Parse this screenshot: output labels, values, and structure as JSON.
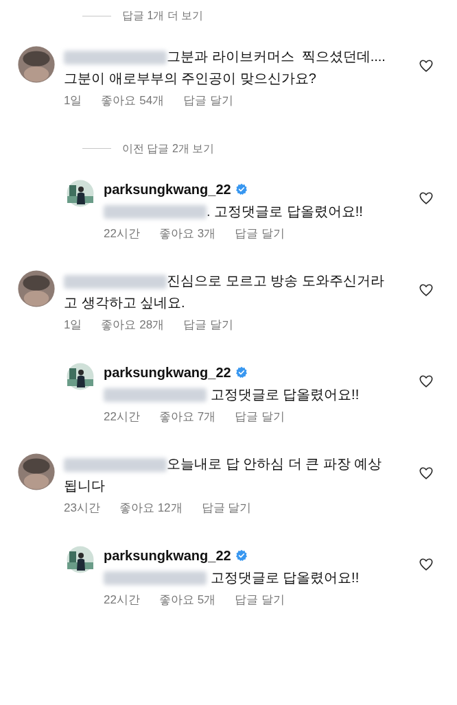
{
  "items": [
    {
      "kind": "view_replies",
      "text": "답글 1개 더 보기"
    },
    {
      "kind": "comment",
      "redacted_prefix": true,
      "text": "그분과 라이브커머스  찍으셨던데.... 그분이 애로부부의 주인공이 맞으신가요?",
      "time": "1일",
      "likes": "좋아요 54개",
      "reply": "답글 달기",
      "liked": false
    },
    {
      "kind": "view_replies",
      "text": "이전 답글 2개 보기"
    },
    {
      "kind": "reply",
      "username": "parksungkwang_22",
      "verified": true,
      "redacted_prefix": true,
      "text": ". 고정댓글로 답올렸어요!!",
      "time": "22시간",
      "likes": "좋아요 3개",
      "reply": "답글 달기",
      "liked": false
    },
    {
      "kind": "comment",
      "redacted_prefix": true,
      "text": "진심으로 모르고 방송 도와주신거라고 생각하고 싶네요.",
      "time": "1일",
      "likes": "좋아요 28개",
      "reply": "답글 달기",
      "liked": false
    },
    {
      "kind": "reply",
      "username": "parksungkwang_22",
      "verified": true,
      "redacted_prefix": true,
      "text": " 고정댓글로 답올렸어요!!",
      "time": "22시간",
      "likes": "좋아요 7개",
      "reply": "답글 달기",
      "liked": false
    },
    {
      "kind": "comment",
      "redacted_prefix": true,
      "text": "오늘내로 답 안하심 더 큰 파장 예상됩니다",
      "time": "23시간",
      "likes": "좋아요 12개",
      "reply": "답글 달기",
      "liked": false
    },
    {
      "kind": "reply",
      "username": "parksungkwang_22",
      "verified": true,
      "redacted_prefix": true,
      "text": " 고정댓글로 답올렸어요!!",
      "time": "22시간",
      "likes": "좋아요 5개",
      "reply": "답글 달기",
      "liked": false
    }
  ]
}
